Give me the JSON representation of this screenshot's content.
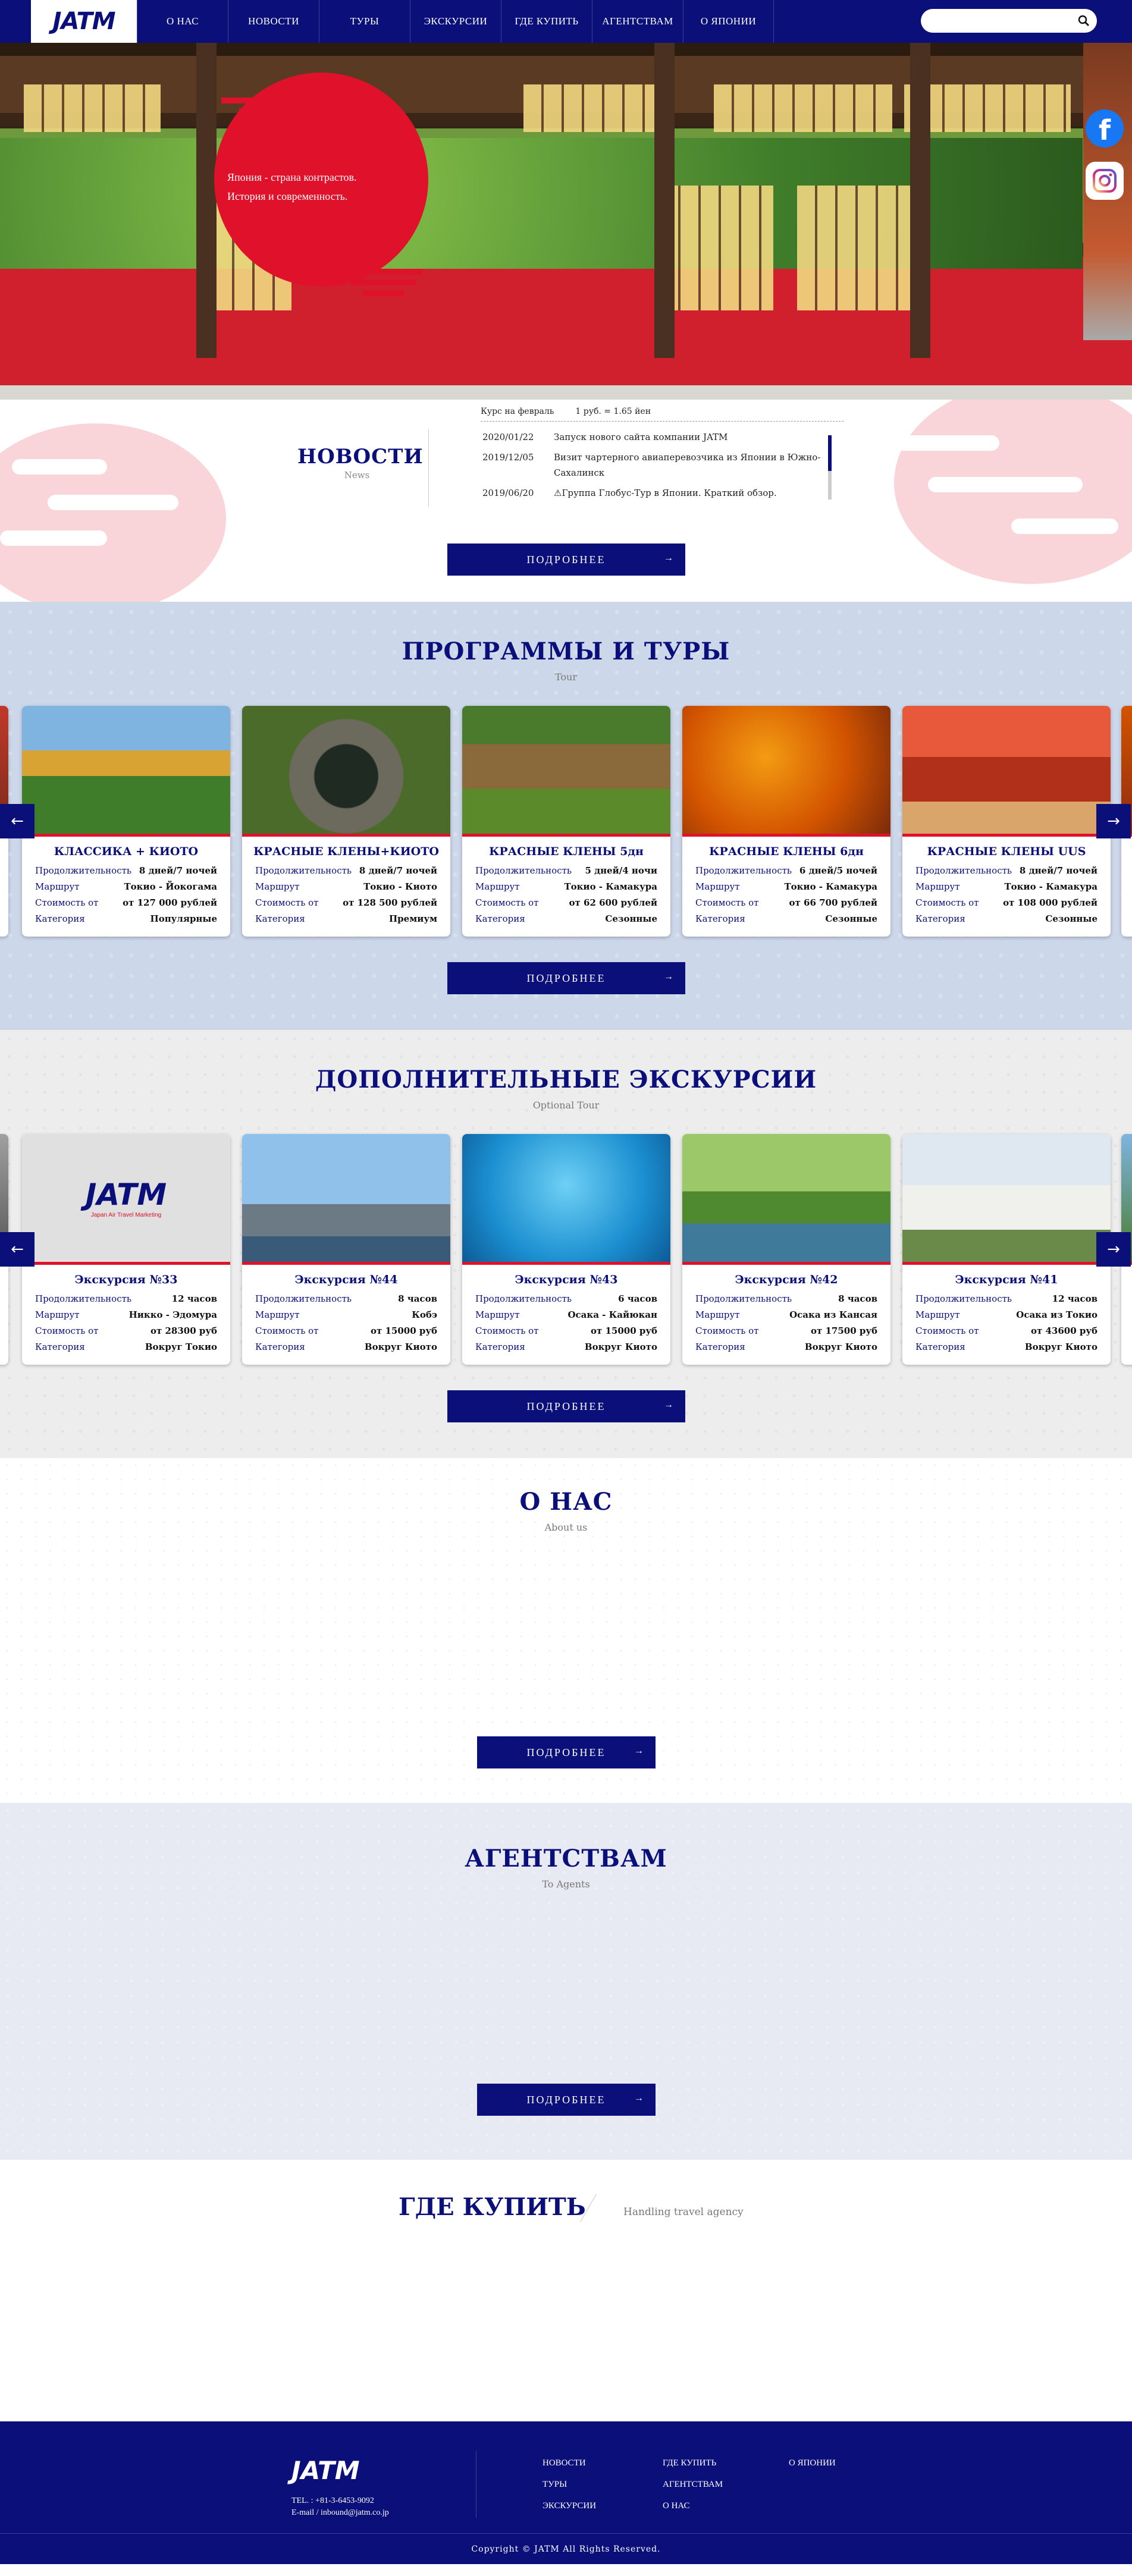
{
  "header": {
    "logo": "JATM",
    "nav": [
      "О НАС",
      "НОВОСТИ",
      "ТУРЫ",
      "ЭКСКУРСИИ",
      "ГДЕ КУПИТЬ",
      "АГЕНТСТВАМ",
      "О ЯПОНИИ"
    ],
    "search_placeholder": ""
  },
  "hero": {
    "tagline_line1": "Япония - страна контрастов.",
    "tagline_line2": "История и современность.",
    "social": [
      "facebook-icon",
      "instagram-icon"
    ]
  },
  "news": {
    "rate_label": "Курс на февраль",
    "rate_value": "1 руб. = 1.65 йен",
    "title": "НОВОСТИ",
    "subtitle": "News",
    "items": [
      {
        "date": "2020/01/22",
        "text": "Запуск нового сайта компании JATM"
      },
      {
        "date": "2019/12/05",
        "text": "Визит чартерного авиаперевозчика из Японии в Южно-Сахалинск"
      },
      {
        "date": "2019/06/20",
        "text": "⚠Группа Глобус-Тур в Японии. Краткий обзор."
      }
    ],
    "more": "ПОДРОБНЕЕ"
  },
  "tours": {
    "title": "ПРОГРАММЫ И ТУРЫ",
    "subtitle": "Tour",
    "labels": {
      "duration": "Продолжительность",
      "route": "Маршрут",
      "price": "Стоимость от",
      "category": "Категория"
    },
    "cards": [
      {
        "title": "КЛАССИКА + КИОТО",
        "duration": "8 дней/7 ночей",
        "route": "Токио - Йокогама",
        "price": "от 127 000 рублей",
        "category": "Популярные"
      },
      {
        "title": "КРАСНЫЕ КЛЕНЫ+КИОТО",
        "duration": "8 дней/7 ночей",
        "route": "Токио - Киото",
        "price": "от 128 500 рублей",
        "category": "Премиум"
      },
      {
        "title": "КРАСНЫЕ КЛЕНЫ 5дн",
        "duration": "5 дней/4 ночи",
        "route": "Токио - Камакура",
        "price": "от 62 600 рублей",
        "category": "Сезонные"
      },
      {
        "title": "КРАСНЫЕ КЛЕНЫ 6дн",
        "duration": "6 дней/5 ночей",
        "route": "Токио - Камакура",
        "price": "от 66 700 рублей",
        "category": "Сезонные"
      },
      {
        "title": "КРАСНЫЕ КЛЕНЫ UUS",
        "duration": "8 дней/7 ночей",
        "route": "Токио - Камакура",
        "price": "от 108 000 рублей",
        "category": "Сезонные"
      }
    ],
    "more": "ПОДРОБНЕЕ"
  },
  "excursions": {
    "title": "ДОПОЛНИТЕЛЬНЫЕ  ЭКСКУРСИИ",
    "subtitle": "Optional Tour",
    "labels": {
      "duration": "Продолжительность",
      "route": "Маршрут",
      "price": "Стоимость от",
      "category": "Категория"
    },
    "placeholder_logo": "JATM",
    "placeholder_tagline": "Japan Air Travel Marketing",
    "cards": [
      {
        "title": "Экскурсия №33",
        "duration": "12 часов",
        "route": "Никко - Эдомура",
        "price": "от 28300 руб",
        "category": "Вокруг Токио"
      },
      {
        "title": "Экскурсия №44",
        "duration": "8 часов",
        "route": "Кобэ",
        "price": "от 15000 руб",
        "category": "Вокруг Киото"
      },
      {
        "title": "Экскурсия №43",
        "duration": "6 часов",
        "route": "Осака - Кайюкан",
        "price": "от 15000 руб",
        "category": "Вокруг Киото"
      },
      {
        "title": "Экскурсия №42",
        "duration": "8 часов",
        "route": "Осака из Кансая",
        "price": "от 17500 руб",
        "category": "Вокруг Киото"
      },
      {
        "title": "Экскурсия №41",
        "duration": "12 часов",
        "route": "Осака из Токио",
        "price": "от 43600 руб",
        "category": "Вокруг Киото"
      }
    ],
    "more": "ПОДРОБНЕЕ"
  },
  "about": {
    "title": "О НАС",
    "subtitle": "About us",
    "more": "ПОДРОБНЕЕ"
  },
  "agents": {
    "title": "АГЕНТСТВАМ",
    "subtitle": "To Agents",
    "more": "ПОДРОБНЕЕ"
  },
  "where": {
    "title": "ГДЕ КУПИТЬ",
    "subtitle": "Handling travel agency"
  },
  "footer": {
    "logo": "JATM",
    "tel": "TEL. : +81-3-6453-9092",
    "email": "E-mail / inbound@jatm.co.jp",
    "col1": [
      "НОВОСТИ",
      "ТУРЫ",
      "ЭКСКУРСИИ"
    ],
    "col2": [
      "ГДЕ КУПИТЬ",
      "АГЕНТСТВАМ",
      "О НАС"
    ],
    "col3": [
      "О ЯПОНИИ"
    ],
    "copyright": "Copyright © JATM All Rights Reserved."
  },
  "colors": {
    "brand": "#0b0f7a",
    "accent": "#e0112a",
    "pink": "#f7c9d0"
  }
}
